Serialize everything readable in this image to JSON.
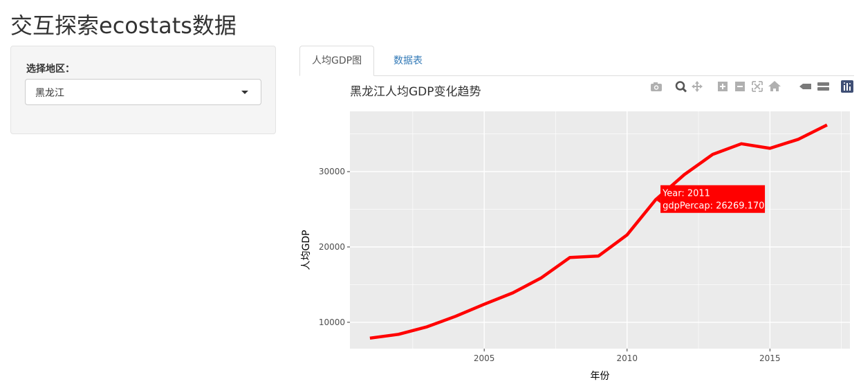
{
  "app": {
    "title": "交互探索ecostats数据"
  },
  "sidebar": {
    "region_label": "选择地区：",
    "region_selected": "黑龙江"
  },
  "tabs": [
    {
      "label": "人均GDP图",
      "active": true
    },
    {
      "label": "数据表",
      "active": false
    }
  ],
  "plot": {
    "modebar_icons": [
      "camera-icon",
      "zoom-icon",
      "pan-icon",
      "zoom-in-icon",
      "zoom-out-icon",
      "autoscale-icon",
      "reset-axes-icon",
      "spike-lines-icon",
      "compare-hover-icon",
      "plotly-logo-icon"
    ]
  },
  "chart_data": {
    "type": "line",
    "title": "黑龙江人均GDP变化趋势",
    "xlabel": "年份",
    "ylabel": "人均GDP",
    "xlim": [
      2000.3,
      2017.8
    ],
    "ylim": [
      6500,
      38000
    ],
    "x_ticks": [
      2005,
      2010,
      2015
    ],
    "x_tick_labels": [
      "2005",
      "2010",
      "2015"
    ],
    "y_ticks": [
      10000,
      20000,
      30000
    ],
    "y_tick_labels": [
      "10000",
      "20000",
      "30000"
    ],
    "grid": true,
    "line_color": "#ff0000",
    "plot_bg": "#ebebeb",
    "x": [
      2001,
      2002,
      2003,
      2004,
      2005,
      2006,
      2007,
      2008,
      2009,
      2010,
      2011,
      2012,
      2013,
      2014,
      2015,
      2016,
      2017
    ],
    "y": [
      7900,
      8400,
      9400,
      10800,
      12400,
      13900,
      15900,
      18600,
      18800,
      21600,
      26269.17,
      29600,
      32300,
      33700,
      33100,
      34300,
      36200
    ],
    "tooltip": {
      "year_text": "Year: 2011",
      "value_text": "gdpPercap: 26269.170"
    }
  }
}
